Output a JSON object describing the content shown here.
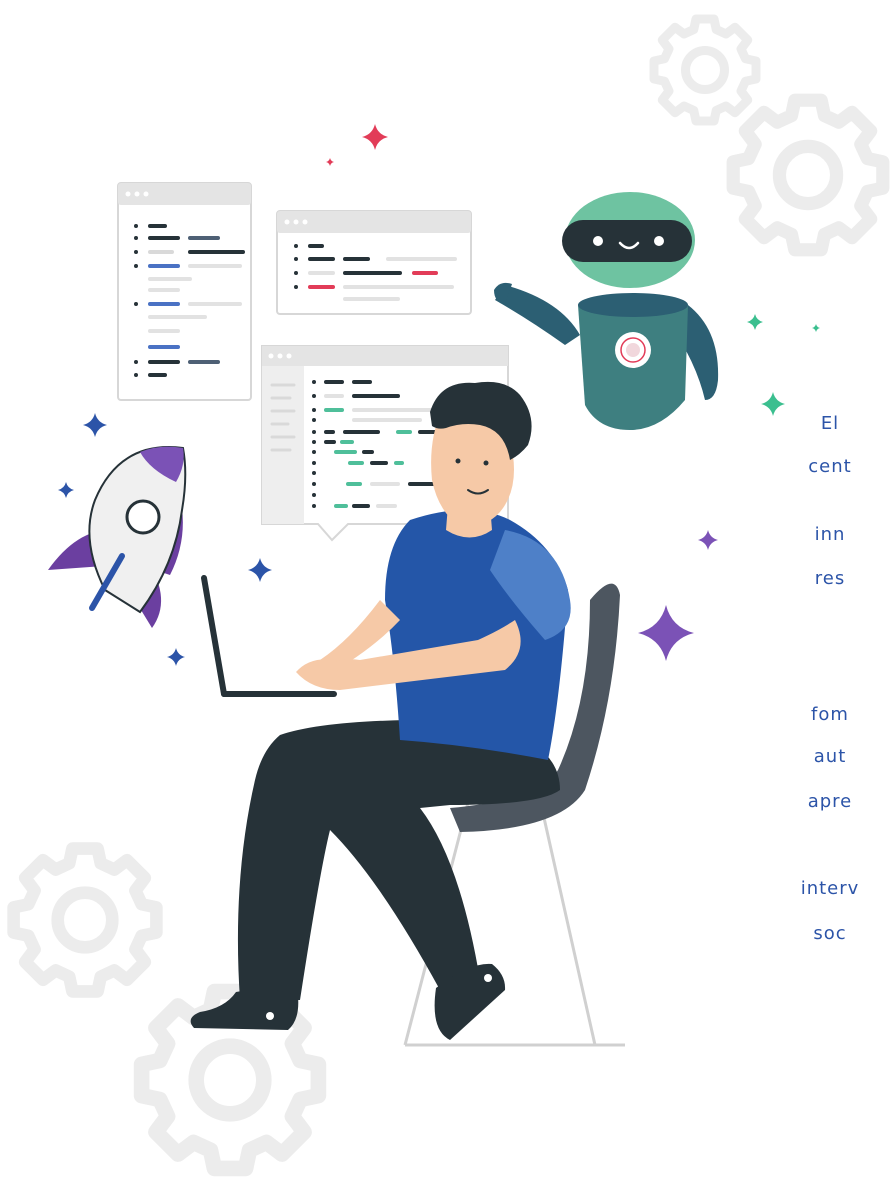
{
  "side_text": {
    "lines": [
      "El",
      "cent",
      "inn",
      "res",
      "fom",
      "aut",
      "apre",
      "interv",
      "soc"
    ]
  },
  "colors": {
    "accent_blue": "#2c54a8",
    "shirt_blue": "#2456a8",
    "robot_green": "#6ec3a1",
    "robot_teal": "#3e7f80",
    "sparkle_purple": "#7b52b6",
    "sparkle_red": "#e23c58",
    "sparkle_green": "#3bbf8f",
    "dark": "#263238",
    "gear_gray": "#ececec"
  },
  "icons": [
    "gear-icon",
    "robot-icon",
    "rocket-icon",
    "sparkle-icon",
    "laptop-icon",
    "code-window-icon",
    "chair-icon"
  ]
}
